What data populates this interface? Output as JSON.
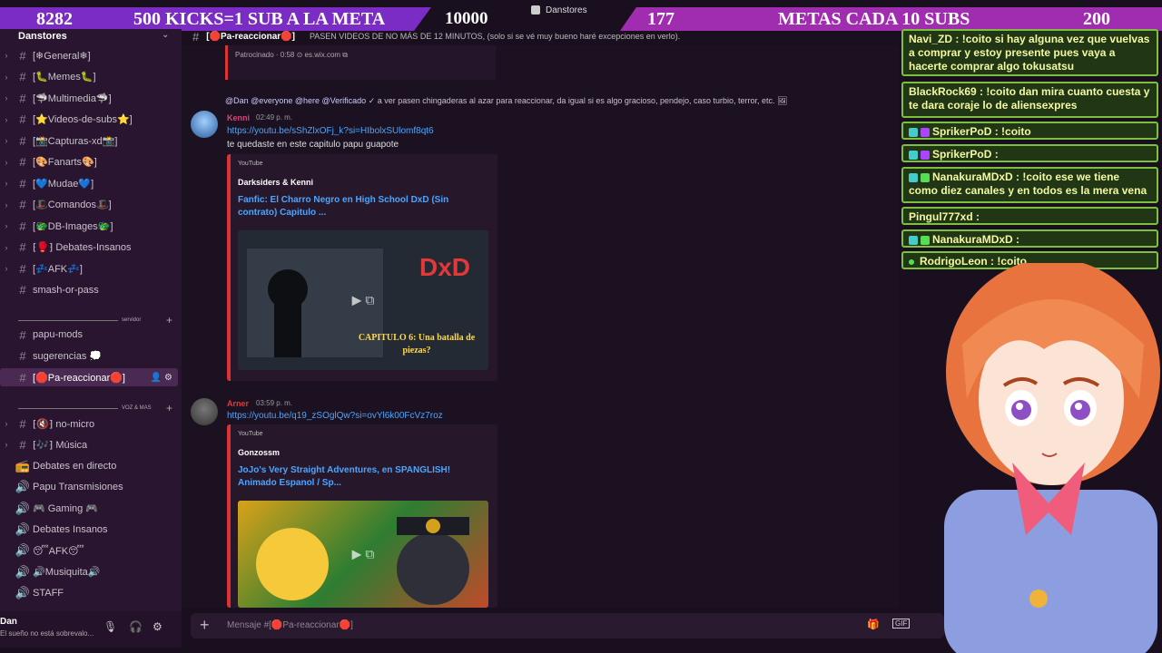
{
  "banner": {
    "left_count": "8282",
    "left_text": "500 KICKS=1 SUB A LA META",
    "goal": "10000",
    "right_count": "177",
    "right_text": "METAS CADA 10 SUBS",
    "right_goal": "200"
  },
  "app": {
    "title": "Danstores"
  },
  "server": {
    "name": "Danstores",
    "channels": [
      {
        "label": "[❄General❄]",
        "collapsed": true
      },
      {
        "label": "[🐛Memes🐛]",
        "collapsed": true
      },
      {
        "label": "[🦈Multimedia🦈]",
        "collapsed": true
      },
      {
        "label": "[⭐Videos-de-subs⭐]",
        "collapsed": true
      },
      {
        "label": "[📸Capturas-xd📸]",
        "collapsed": true
      },
      {
        "label": "[🎨Fanarts🎨]",
        "collapsed": true
      },
      {
        "label": "[💙Mudae💙]",
        "collapsed": true
      },
      {
        "label": "[🎩Comandos🎩]",
        "collapsed": true
      },
      {
        "label": "[🐲DB-Images🐲]",
        "collapsed": true
      },
      {
        "label": "⁅🥊⁆ Debates-Insanos",
        "collapsed": true
      },
      {
        "label": "[💤AFK💤]",
        "collapsed": true
      },
      {
        "label": "smash-or-pass",
        "collapsed": false
      }
    ],
    "category_1": "servidor",
    "channels2": [
      {
        "label": "papu-mods"
      },
      {
        "label": "sugerencias 💭"
      },
      {
        "label": "[🛑Pa-reaccionar🛑]"
      }
    ],
    "category_2": "VOZ & MAS",
    "voice": [
      {
        "label": "⁅🔇⁆ no-micro",
        "icon": "#"
      },
      {
        "label": "⁅🎶⁆ Música",
        "icon": "#"
      },
      {
        "label": "Debates en directo",
        "icon": "📻"
      },
      {
        "label": "Papu Transmisiones",
        "icon": "🔊"
      },
      {
        "label": "🎮 Gaming 🎮",
        "icon": "🔊"
      },
      {
        "label": "Debates Insanos",
        "icon": "🔊"
      },
      {
        "label": "😴AFK😴",
        "icon": "🔊"
      },
      {
        "label": "🔊Musiquita🔊",
        "icon": "🔊"
      },
      {
        "label": "STAFF",
        "icon": "🔊"
      }
    ]
  },
  "user": {
    "name": "Dan",
    "status": "El sueño no está sobrevalo..."
  },
  "header": {
    "channel": "[🛑Pa-reaccionar🛑]",
    "topic": "PASEN VIDEOS DE NO MÁS DE 12 MINUTOS, (solo si se vé muy bueno haré excepciones en verlo)."
  },
  "messages": {
    "sponsor": "Patrocinado · 0:58 ⊙ es.wix.com ⧉",
    "reply": {
      "at": "@Dan",
      "mentions": [
        "@everyone",
        "@here",
        "@Verificado"
      ],
      "text": "✓ a ver pasen chingaderas al azar para reaccionar, da igual si es algo gracioso, pendejo, caso turbio, terror, etc. 🖼"
    },
    "m1": {
      "author": "Kenni",
      "time": "02:49 p. m.",
      "link": "https://youtu.be/sShZlxOFj_k?si=HIbolxSUlomf8qt6",
      "text": "te quedaste en este capitulo papu guapote",
      "embed_provider": "YouTube",
      "embed_author": "Darksiders & Kenni",
      "embed_title": "Fanfic: El Charro Negro en High School DxD (Sin contrato) Capitulo ...",
      "thumb_text": "CAPITULO 6: Una batalla de piezas?"
    },
    "m2": {
      "author": "Arner",
      "time": "03:59 p. m.",
      "link": "https://youtu.be/q19_zSOglQw?si=ovYl6k00FcVz7roz",
      "embed_provider": "YouTube",
      "embed_author": "Gonzossm",
      "embed_title": "JoJo's Very Straight Adventures, en SPANGLISH! Animado Espanol / Sp..."
    }
  },
  "input": {
    "placeholder": "Mensaje #[🛑Pa-reaccionar🛑]"
  },
  "chat": [
    {
      "name": "Navi_ZD",
      "text": "!coito si hay alguna vez que vuelvas a comprar y estoy presente pues vaya a hacerte comprar algo tokusatsu"
    },
    {
      "name": "BlackRock69",
      "text": "!coito dan mira cuanto cuesta y te dara coraje lo de aliensexpres"
    },
    {
      "name": "SprikerPoD",
      "text": "!coito"
    },
    {
      "name": "SprikerPoD",
      "text": ""
    },
    {
      "name": "NanakuraMDxD",
      "text": "!coito ese we tiene como diez canales y en todos es la mera vena"
    },
    {
      "name": "Pingul777xd",
      "text": ""
    },
    {
      "name": "NanakuraMDxD",
      "text": ""
    },
    {
      "name": "RodrigoLeon",
      "text": "!coito"
    }
  ],
  "colors": {
    "accent": "#7b2cc4",
    "link": "#4aa6ff",
    "chat_border": "#7dbf3f",
    "chat_text": "#f3f9a0"
  }
}
